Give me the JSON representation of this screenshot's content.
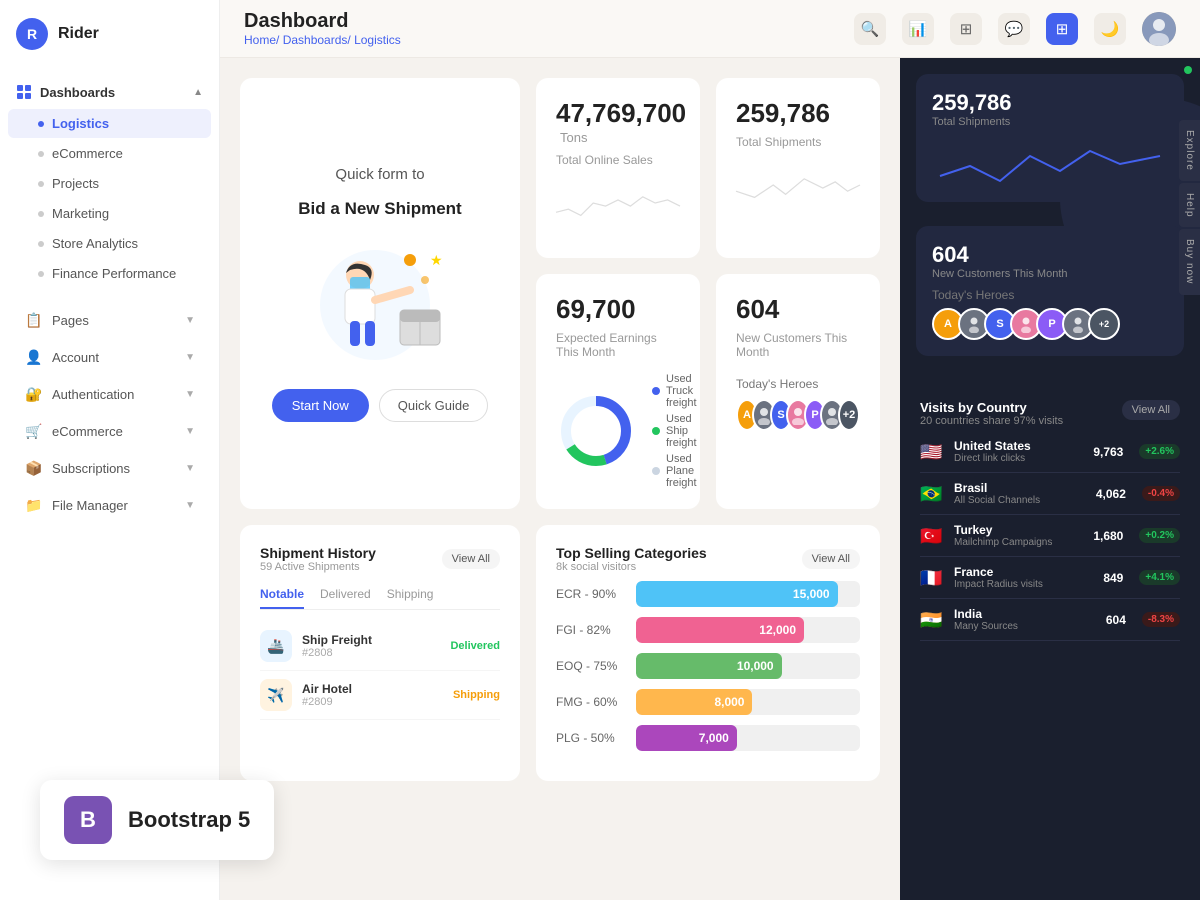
{
  "app": {
    "logo_initial": "R",
    "logo_name": "Rider"
  },
  "sidebar": {
    "dashboards_label": "Dashboards",
    "logistics_label": "Logistics",
    "ecommerce_label": "eCommerce",
    "projects_label": "Projects",
    "marketing_label": "Marketing",
    "store_analytics_label": "Store Analytics",
    "finance_performance_label": "Finance Performance",
    "pages_label": "Pages",
    "account_label": "Account",
    "authentication_label": "Authentication",
    "ecommerce2_label": "eCommerce",
    "subscriptions_label": "Subscriptions",
    "file_manager_label": "File Manager"
  },
  "header": {
    "title": "Dashboard",
    "breadcrumb_home": "Home/",
    "breadcrumb_dashboards": "Dashboards/",
    "breadcrumb_current": "Logistics"
  },
  "shipment_card": {
    "title": "Quick form to",
    "subtitle": "Bid a New Shipment",
    "start_now": "Start Now",
    "quick_guide": "Quick Guide"
  },
  "stats": {
    "total_sales_number": "47,769,700",
    "total_sales_unit": "Tons",
    "total_sales_label": "Total Online Sales",
    "total_shipments_number": "259,786",
    "total_shipments_label": "Total Shipments",
    "earnings_number": "69,700",
    "earnings_label": "Expected Earnings This Month",
    "customers_number": "604",
    "customers_label": "New Customers This Month"
  },
  "freight_legend": [
    {
      "label": "Used Truck freight",
      "pct": "45%",
      "color": "#4361ee"
    },
    {
      "label": "Used Ship freight",
      "pct": "21%",
      "color": "#22c55e"
    },
    {
      "label": "Used Plane freight",
      "pct": "34%",
      "color": "#e2e8f0"
    }
  ],
  "heroes": {
    "label": "Today's Heroes",
    "avatars": [
      {
        "initial": "A",
        "color": "#f59e0b"
      },
      {
        "initial": "",
        "color": "#888"
      },
      {
        "initial": "S",
        "color": "#4361ee"
      },
      {
        "initial": "",
        "color": "#e879a0"
      },
      {
        "initial": "P",
        "color": "#8b5cf6"
      },
      {
        "initial": "",
        "color": "#6b7280"
      },
      {
        "initial": "+2",
        "color": "#4b5563"
      }
    ]
  },
  "shipment_history": {
    "title": "Shipment History",
    "subtitle": "59 Active Shipments",
    "view_all": "View All",
    "tabs": [
      "Notable",
      "Delivered",
      "Shipping"
    ],
    "active_tab": "Notable",
    "items": [
      {
        "name": "Ship Freight",
        "id": "#2808",
        "status": "Delivered",
        "icon": "🚢"
      },
      {
        "name": "Air Hotel",
        "id": "#2809",
        "status": "Shipping",
        "icon": "✈️"
      }
    ]
  },
  "top_selling": {
    "title": "Top Selling Categories",
    "subtitle": "8k social visitors",
    "view_all": "View All",
    "bars": [
      {
        "label": "ECR - 90%",
        "value": 15000,
        "display": "15,000",
        "color": "#4fc3f7",
        "width": "90%"
      },
      {
        "label": "FGI - 82%",
        "value": 12000,
        "display": "12,000",
        "color": "#f06292",
        "width": "75%"
      },
      {
        "label": "EOQ - 75%",
        "value": 10000,
        "display": "10,000",
        "color": "#66bb6a",
        "width": "65%"
      },
      {
        "label": "FMG - 60%",
        "value": 8000,
        "display": "8,000",
        "color": "#ffb74d",
        "width": "52%"
      },
      {
        "label": "PLG - 50%",
        "value": 7000,
        "display": "7,000",
        "color": "#ab47bc",
        "width": "45%"
      }
    ]
  },
  "visits": {
    "title": "Visits by Country",
    "subtitle": "20 countries share 97% visits",
    "view_all": "View All",
    "countries": [
      {
        "flag": "🇺🇸",
        "name": "United States",
        "source": "Direct link clicks",
        "visits": "9,763",
        "change": "+2.6%",
        "up": true
      },
      {
        "flag": "🇧🇷",
        "name": "Brasil",
        "source": "All Social Channels",
        "visits": "4,062",
        "change": "-0.4%",
        "up": false
      },
      {
        "flag": "🇹🇷",
        "name": "Turkey",
        "source": "Mailchimp Campaigns",
        "visits": "1,680",
        "change": "+0.2%",
        "up": true
      },
      {
        "flag": "🇫🇷",
        "name": "France",
        "source": "Impact Radius visits",
        "visits": "849",
        "change": "+4.1%",
        "up": true
      },
      {
        "flag": "🇮🇳",
        "name": "India",
        "source": "Many Sources",
        "visits": "604",
        "change": "-8.3%",
        "up": false
      }
    ]
  },
  "side_tabs": [
    "Explore",
    "Help",
    "Buy now"
  ],
  "bootstrap": {
    "icon": "B",
    "label": "Bootstrap 5"
  }
}
